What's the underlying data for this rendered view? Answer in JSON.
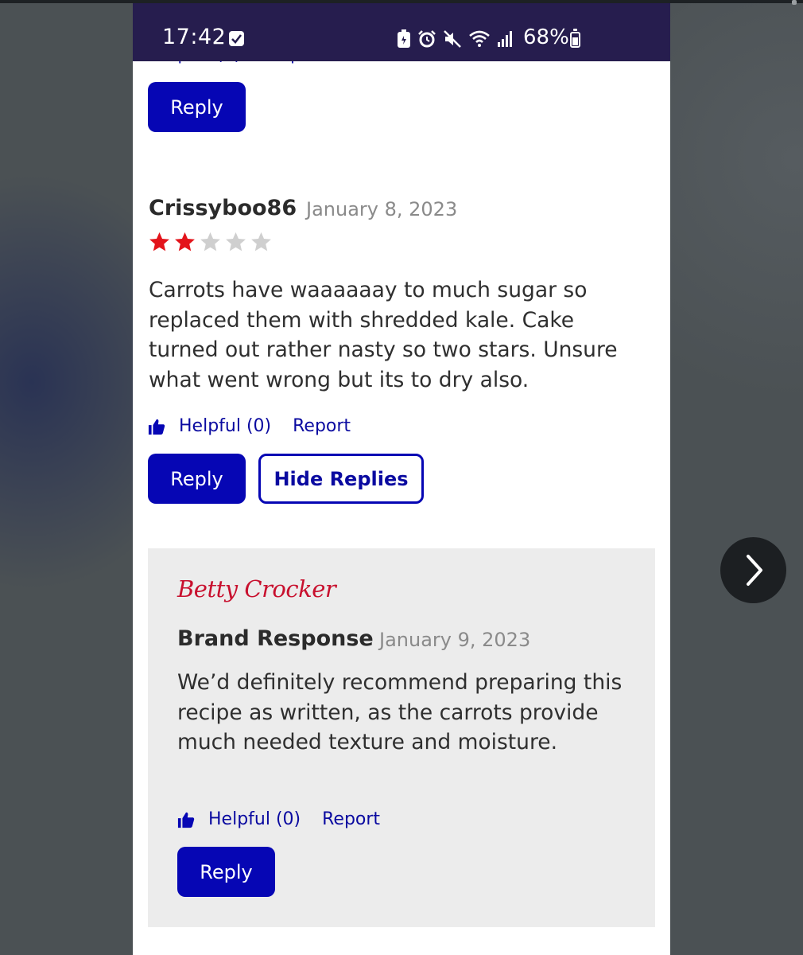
{
  "status_bar": {
    "time": "17:42",
    "battery_percent": "68%",
    "icons": [
      "checkbox-icon",
      "battery-saver-icon",
      "alarm-icon",
      "mute-icon",
      "wifi-icon",
      "signal-icon",
      "battery-icon"
    ],
    "background_color": "#261d4e"
  },
  "previous_review": {
    "reply_label": "Reply"
  },
  "review": {
    "username": "Crissyboo86",
    "date": "January 8, 2023",
    "rating": 2,
    "max_rating": 5,
    "star_color": "#e3141b",
    "empty_star_color": "#cfcfcf",
    "text": "Carrots have waaaaaay to much sugar so replaced them with shredded kale. Cake turned out rather nasty so two stars. Unsure what went wrong but its to dry also.",
    "helpful_label": "Helpful (0)",
    "report_label": "Report",
    "reply_label": "Reply",
    "hide_replies_label": "Hide Replies"
  },
  "brand_response": {
    "logo_text": "Betty Crocker",
    "title": "Brand Response",
    "date": "January 9, 2023",
    "text": "We’d definitely recommend preparing this recipe as written, as the carrots provide much needed texture and moisture.",
    "helpful_label": "Helpful (0)",
    "report_label": "Report",
    "reply_label": "Reply"
  },
  "colors": {
    "primary_button": "#0606b4",
    "link": "#0a0aa0",
    "brand_red": "#c8102e"
  },
  "gallery": {
    "next_icon": "chevron-right-icon"
  }
}
